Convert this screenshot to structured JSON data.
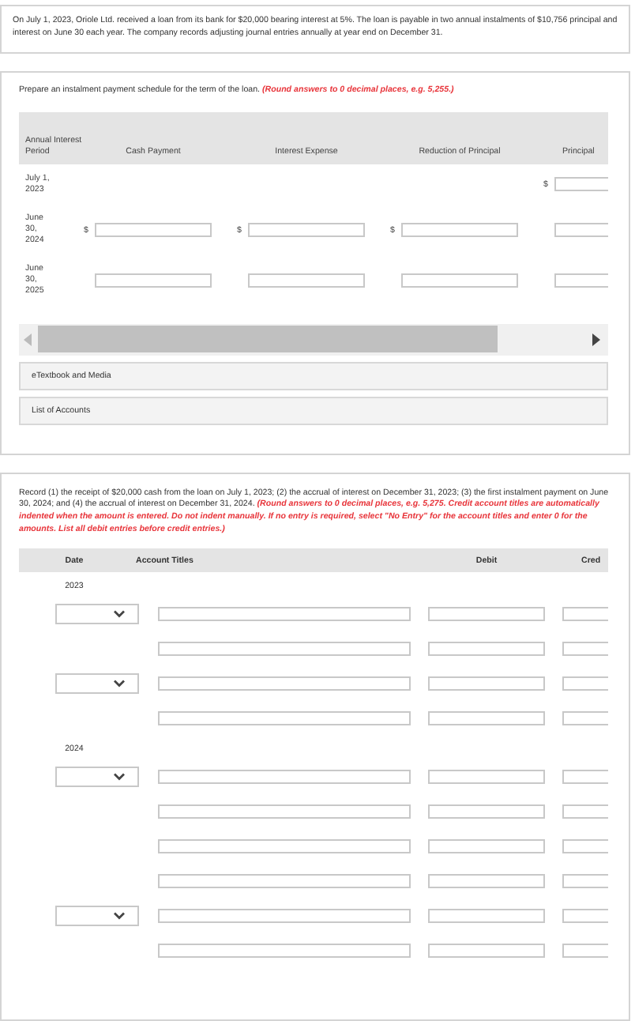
{
  "problem": {
    "text": "On July 1, 2023, Oriole Ltd. received a loan from its bank for $20,000 bearing interest at 5%. The loan is payable in two annual instalments of $10,756 principal and interest on June 30 each year. The company records adjusting journal entries annually at year end on December 31."
  },
  "schedule_part": {
    "instruction": "Prepare an instalment payment schedule for the term of the loan.",
    "note": "(Round answers to 0 decimal places, e.g. 5,255.)",
    "columns": [
      "Annual Interest Period",
      "Cash Payment",
      "Interest Expense",
      "Reduction of Principal",
      "Principal"
    ],
    "rows": [
      {
        "period": "July 1, 2023",
        "cells": [
          {
            "kind": "blank"
          },
          {
            "kind": "blank"
          },
          {
            "kind": "blank"
          },
          {
            "kind": "input",
            "currency": "$"
          }
        ]
      },
      {
        "period": "June 30, 2024",
        "cells": [
          {
            "kind": "input",
            "currency": "$"
          },
          {
            "kind": "input",
            "currency": "$"
          },
          {
            "kind": "input",
            "currency": "$"
          },
          {
            "kind": "input"
          }
        ]
      },
      {
        "period": "June 30, 2025",
        "cells": [
          {
            "kind": "input"
          },
          {
            "kind": "input"
          },
          {
            "kind": "input"
          },
          {
            "kind": "input"
          }
        ]
      }
    ],
    "links": [
      "eTextbook and Media",
      "List of Accounts"
    ]
  },
  "journal_part": {
    "instruction": "Record (1) the receipt of $20,000 cash from the loan on July 1, 2023; (2) the accrual of interest on December 31, 2023; (3) the first instalment payment on June 30, 2024; and (4) the accrual of interest on December 31, 2024.",
    "note": "(Round answers to 0 decimal places, e.g. 5,275. Credit account titles are automatically indented when the amount is entered. Do not indent manually. If no entry is required, select \"No Entry\" for the account titles and enter 0 for the amounts. List all debit entries before credit entries.)",
    "columns": [
      "Date",
      "Account Titles",
      "Debit",
      "Cred"
    ],
    "years": [
      {
        "year": "2023",
        "lines": [
          {
            "kind": "dated"
          },
          {
            "kind": "plain"
          },
          {
            "kind": "dated"
          },
          {
            "kind": "plain"
          }
        ]
      },
      {
        "year": "2024",
        "lines": [
          {
            "kind": "dated"
          },
          {
            "kind": "plain"
          },
          {
            "kind": "plain"
          },
          {
            "kind": "plain"
          },
          {
            "kind": "dated"
          },
          {
            "kind": "plain"
          }
        ]
      }
    ]
  }
}
